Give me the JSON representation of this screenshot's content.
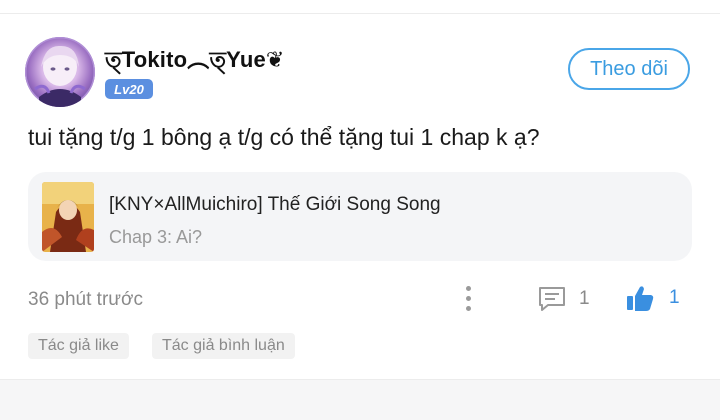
{
  "comment": {
    "username": "ত্Tokito︵ত্Yue❦",
    "level": "Lv20",
    "follow_label": "Theo dõi",
    "text": "tui tặng t/g 1 bông ạ t/g có thể tặng tui 1 chap k ạ?",
    "story": {
      "title": "[KNY×AllMuichiro] Thế Giới Song Song",
      "chapter": "Chap 3: Ai?"
    },
    "timestamp": "36 phút trước",
    "reply_count": "1",
    "like_count": "1",
    "tags": [
      "Tác giả like",
      "Tác giả bình luận"
    ]
  },
  "colors": {
    "accent": "#4aa6e8",
    "level_badge": "#5b8fe0",
    "like_blue": "#3a8fe0",
    "card_bg": "#f4f5f7",
    "muted_text": "#8a8a8a"
  },
  "icons": {
    "more": "vertical-dots-icon",
    "reply": "comment-bubble-icon",
    "like": "thumbs-up-icon"
  }
}
